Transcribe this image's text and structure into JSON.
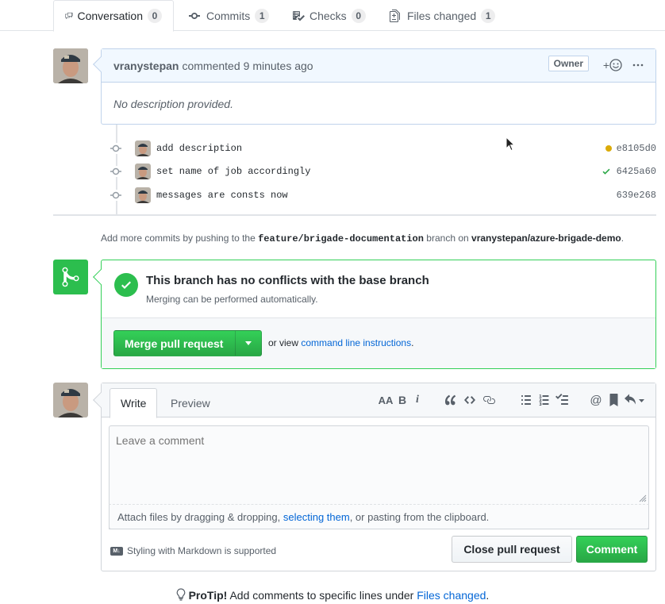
{
  "tabs": [
    {
      "label": "Conversation",
      "count": "0",
      "icon": "conversation-icon"
    },
    {
      "label": "Commits",
      "count": "1",
      "icon": "commit-icon"
    },
    {
      "label": "Checks",
      "count": "0",
      "icon": "checklist-icon"
    },
    {
      "label": "Files changed",
      "count": "1",
      "icon": "diff-icon"
    }
  ],
  "comment": {
    "author": "vranystepan",
    "action": "commented",
    "time": "9 minutes ago",
    "badge": "Owner",
    "reaction_label": "+",
    "body": "No description provided."
  },
  "commits": [
    {
      "message": "add description",
      "sha": "e8105d0",
      "status": "pending",
      "status_color": "#dbab09"
    },
    {
      "message": "set name of job accordingly",
      "sha": "6425a60",
      "status": "success",
      "status_color": "#28a745"
    },
    {
      "message": "messages are consts now",
      "sha": "639e268",
      "status": "none",
      "status_color": ""
    }
  ],
  "push_info": {
    "prefix": "Add more commits by pushing to the",
    "branch": "feature/brigade-documentation",
    "middle": "branch on",
    "repo": "vranystepan/azure-brigade-demo",
    "suffix": "."
  },
  "merge": {
    "title": "This branch has no conflicts with the base branch",
    "subtitle": "Merging can be performed automatically.",
    "button": "Merge pull request",
    "or_view": "or view",
    "cli_link": "command line instructions",
    "period": "."
  },
  "editor": {
    "tabs": {
      "write": "Write",
      "preview": "Preview"
    },
    "placeholder": "Leave a comment",
    "attach_prefix": "Attach files by dragging & dropping,",
    "attach_link": "selecting them",
    "attach_suffix": ", or pasting from the clipboard.",
    "markdown_badge": "M↓",
    "markdown_note": "Styling with Markdown is supported",
    "close_button": "Close pull request",
    "comment_button": "Comment",
    "toolbar": {
      "heading": "AA",
      "bold": "B",
      "italic": "i",
      "mention": "@"
    }
  },
  "protip": {
    "label": "ProTip!",
    "text": "Add comments to specific lines under",
    "link": "Files changed",
    "suffix": "."
  },
  "colors": {
    "accent_blue": "#0366d6",
    "success_green": "#2cbe4e",
    "comment_header_bg": "#f1f8ff"
  }
}
